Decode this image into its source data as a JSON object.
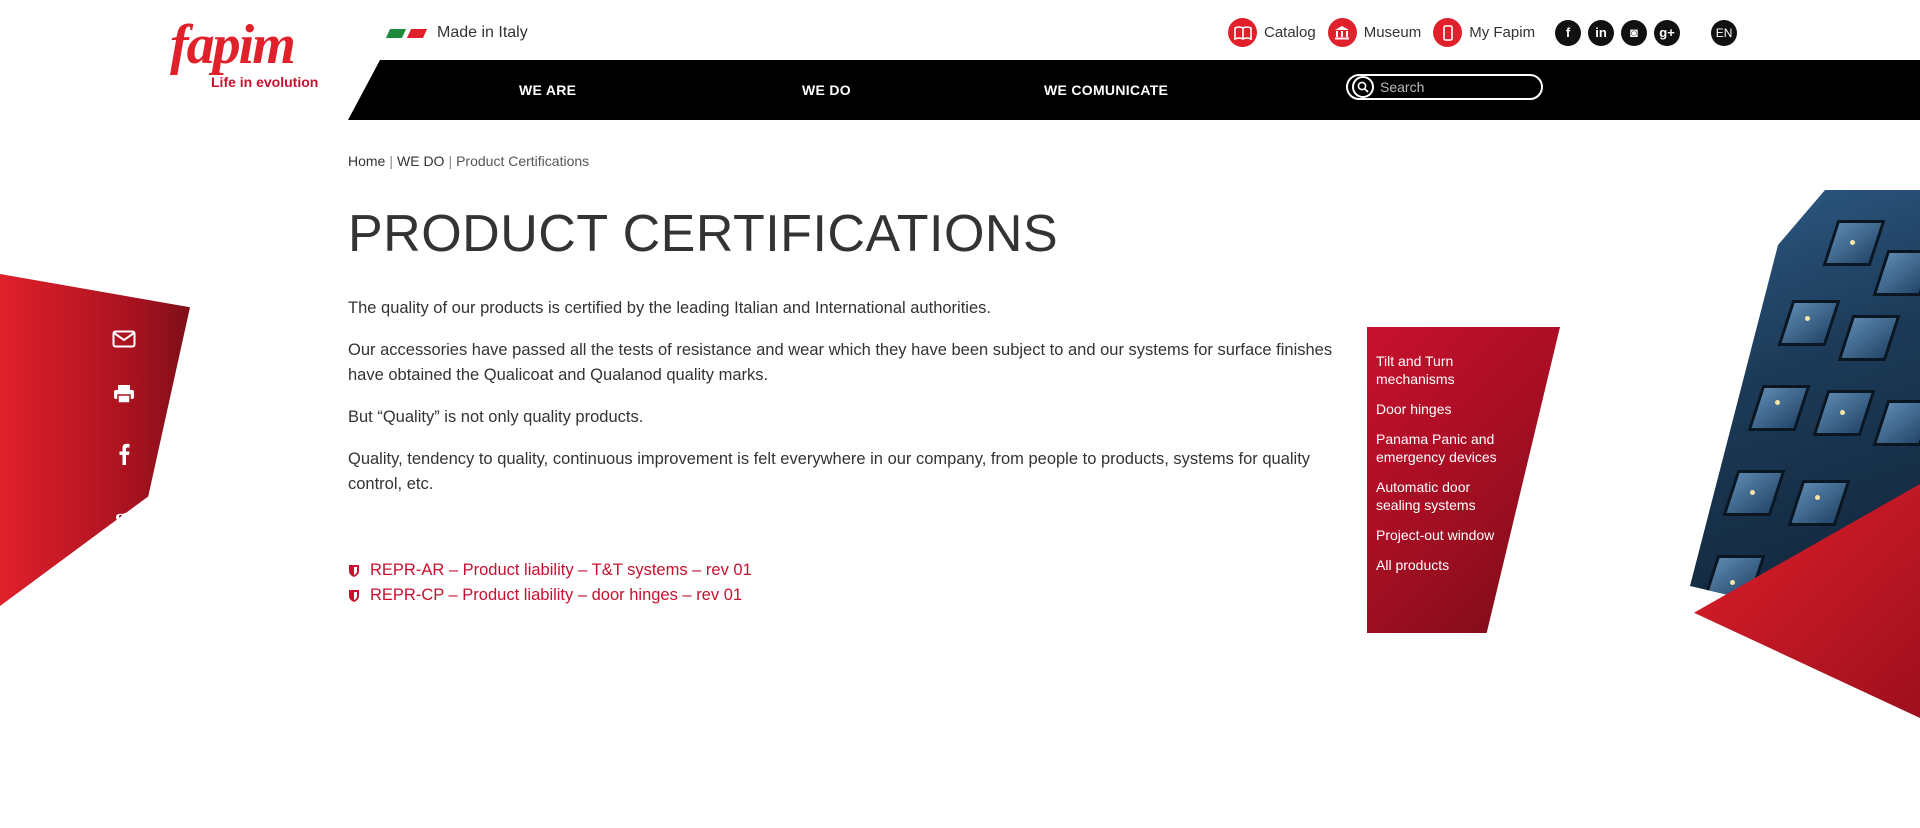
{
  "brand": {
    "name": "fapim",
    "tagline": "Life in evolution",
    "color": "#e0202b"
  },
  "made_in": "Made in Italy",
  "top_links": [
    {
      "label": "Catalog",
      "icon": "book-icon"
    },
    {
      "label": "Museum",
      "icon": "museum-icon"
    },
    {
      "label": "My Fapim",
      "icon": "mobile-icon"
    }
  ],
  "social": [
    {
      "label": "f",
      "icon": "facebook-icon"
    },
    {
      "label": "in",
      "icon": "linkedin-icon"
    },
    {
      "label": "◙",
      "icon": "instagram-icon"
    },
    {
      "label": "g+",
      "icon": "google-plus-icon"
    }
  ],
  "language": "EN",
  "nav": {
    "items": [
      "WE ARE",
      "WE DO",
      "WE COMUNICATE"
    ]
  },
  "search": {
    "placeholder": "Search"
  },
  "breadcrumb": {
    "home": "Home",
    "section": "WE DO",
    "current": "Product Certifications"
  },
  "page": {
    "title": "PRODUCT CERTIFICATIONS",
    "paragraphs": [
      "The quality of our products is certified by the leading Italian and International authorities.",
      "Our accessories have passed all the tests of resistance and wear which they have been subject to and our systems for surface finishes have obtained the Qualicoat and Qualanod quality marks.",
      "But “Quality” is not only quality products.",
      "Quality, tendency to quality, continuous improvement is felt everywhere in our company, from people to products, systems for quality control, etc."
    ],
    "documents": [
      "REPR-AR – Product liability – T&T systems – rev 01",
      "REPR-CP – Product liability – door hinges – rev 01"
    ]
  },
  "share": {
    "icons": [
      "email-icon",
      "print-icon",
      "facebook-icon",
      "google-plus-icon"
    ]
  },
  "products": {
    "items": [
      "Tilt and Turn mechanisms",
      "Door hinges",
      "Panama Panic and emergency devices",
      "Automatic door sealing systems",
      "Project-out window",
      "All products"
    ]
  }
}
